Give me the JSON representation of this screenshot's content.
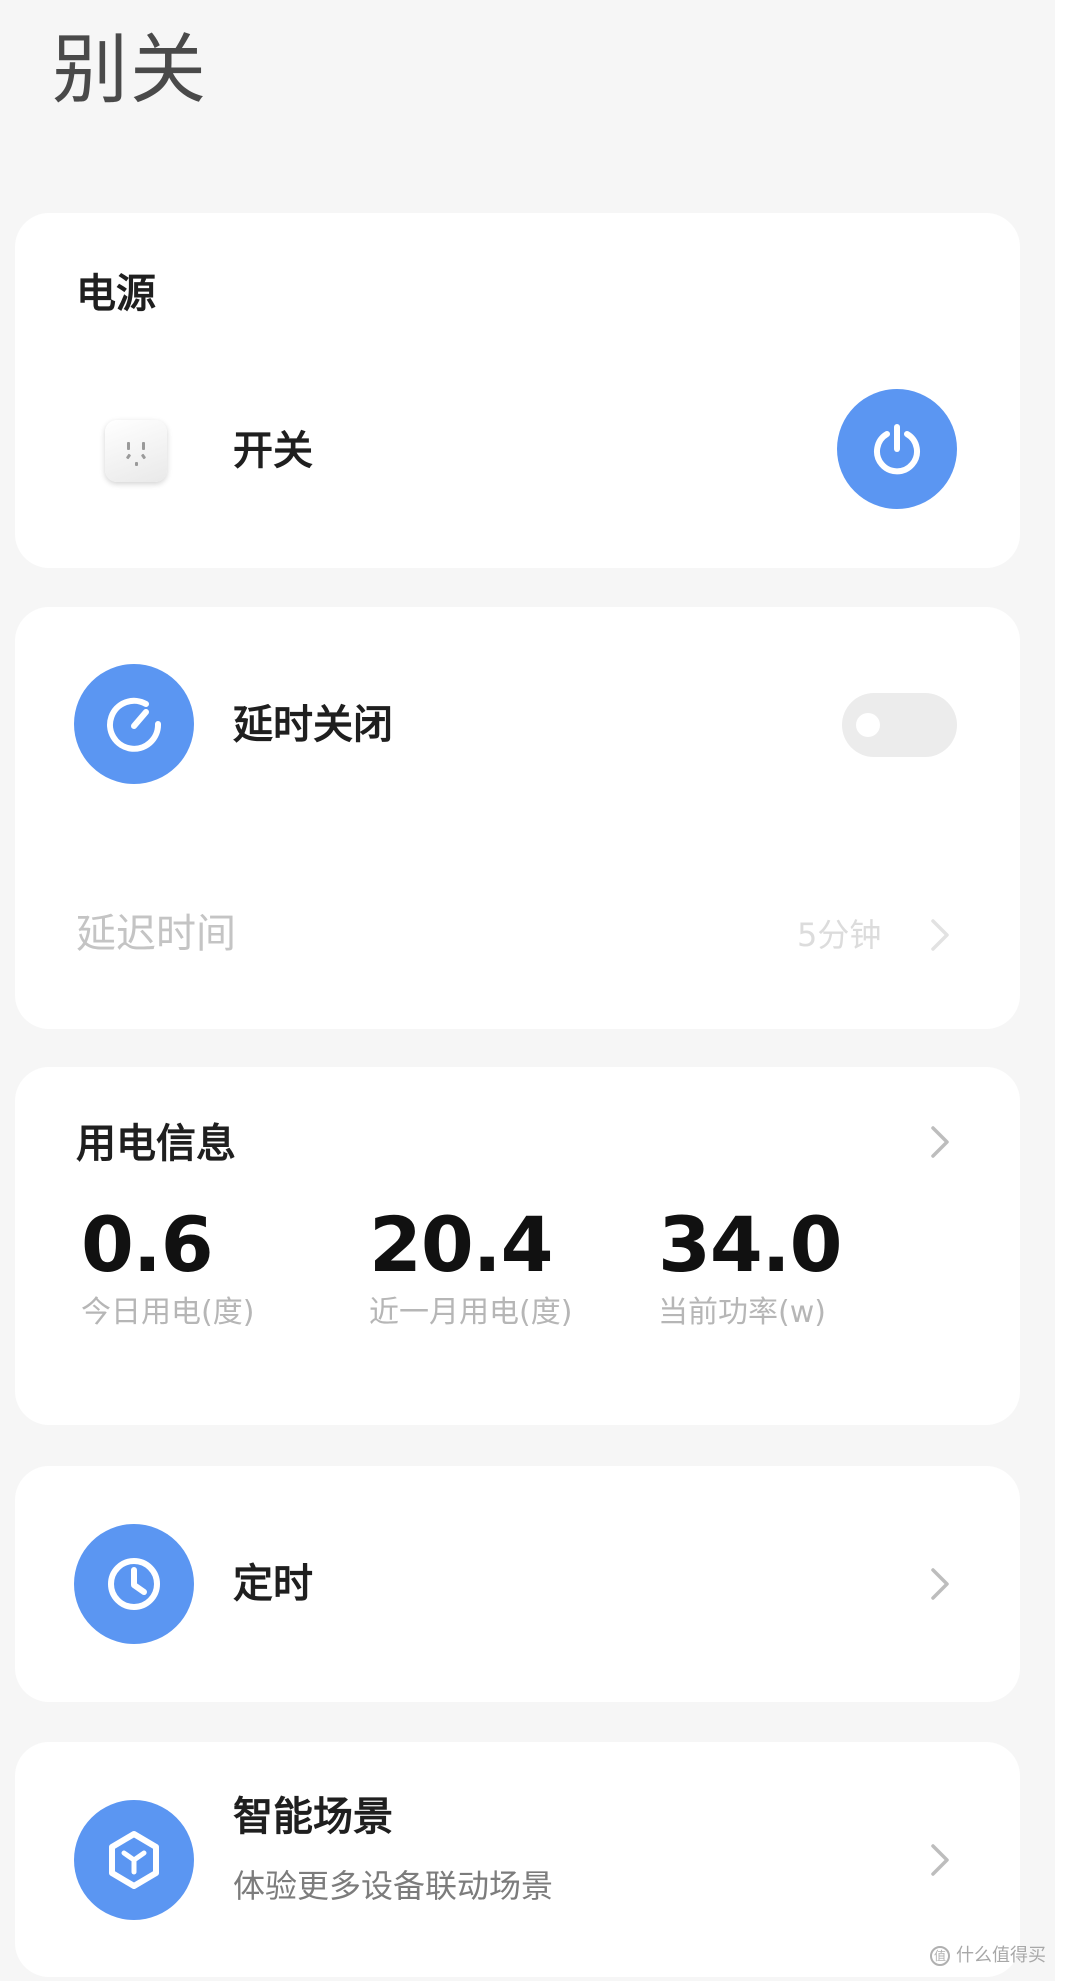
{
  "page": {
    "title": "别关"
  },
  "power_card": {
    "title": "电源",
    "switch_label": "开关",
    "switch_on": true,
    "socket_icon": "power-socket-icon",
    "button_icon": "power-icon"
  },
  "delay_card": {
    "label": "延时关闭",
    "enabled": false,
    "icon": "countdown-icon",
    "delay_time_label": "延迟时间",
    "delay_time_value": "5分钟"
  },
  "usage_card": {
    "title": "用电信息",
    "metrics": [
      {
        "value": "0.6",
        "label": "今日用电(度)"
      },
      {
        "value": "20.4",
        "label": "近一月用电(度)"
      },
      {
        "value": "34.0",
        "label": "当前功率(w)"
      }
    ]
  },
  "timer_card": {
    "label": "定时",
    "icon": "clock-icon"
  },
  "scene_card": {
    "label": "智能场景",
    "subtitle": "体验更多设备联动场景",
    "icon": "scene-icon"
  },
  "colors": {
    "accent": "#5b96f2",
    "background": "#f6f6f6",
    "card": "#ffffff"
  },
  "watermark": {
    "text": "什么值得买",
    "badge": "值"
  }
}
